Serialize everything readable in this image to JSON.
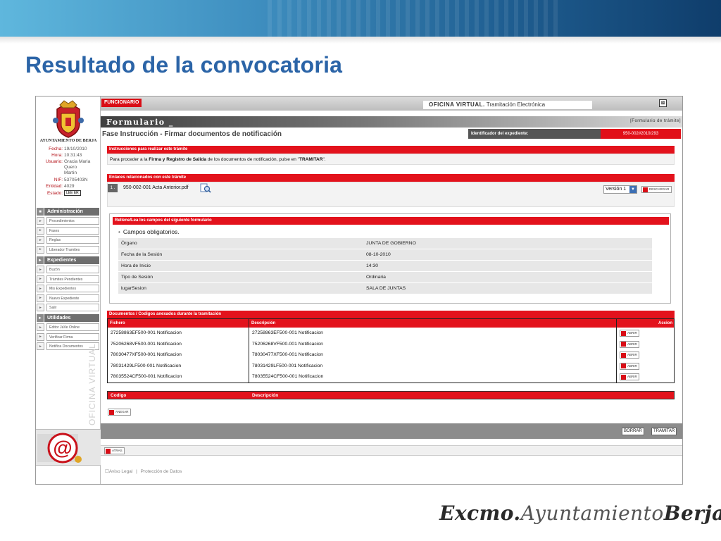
{
  "slide": {
    "title": "Resultado de la convocatoria",
    "footer": {
      "part1": "Excmo.",
      "part2": "Ayuntamiento",
      "part3": "Berja"
    }
  },
  "left": {
    "municipality": "AYUNTAMIENTO DE BERJA",
    "info": [
      {
        "key": "Fecha:",
        "value": "19/10/2010"
      },
      {
        "key": "Hora:",
        "value": "10:31:43"
      },
      {
        "key": "Usuario:",
        "value": "Gracia Maria"
      },
      {
        "key": "",
        "value": "Quero"
      },
      {
        "key": "",
        "value": "Martin"
      },
      {
        "key": "NIF:",
        "value": "53705403N"
      },
      {
        "key": "Entidad:",
        "value": "4029"
      }
    ],
    "estado_key": "Estado:",
    "estado_btn": "LEE ER",
    "vertical_text": "OFICINA VIRTUAL",
    "sections": [
      {
        "title": "Administración",
        "items": [
          "Procedimientos",
          "Fases",
          "Reglas",
          "Liberador Tramites"
        ]
      },
      {
        "title": "Expedientes",
        "items": [
          "Buzón",
          "Trámites Pendientes",
          "Mis Expedientes",
          "Nuevo Expediente",
          "Salir"
        ]
      },
      {
        "title": "Utilidades",
        "items": [
          "Editor JaVe Online",
          "Verificar Firma",
          "Notifica Documentos"
        ]
      }
    ]
  },
  "header": {
    "role_tag": "FUNCIONARIO",
    "app_name": "OFICINA VIRTUAL.",
    "app_sub": "Tramitación Electrónica",
    "close": "⊠"
  },
  "form": {
    "title": "Formulario _",
    "link": "[Formulario de trámite]",
    "phase": "Fase Instrucción - Firmar documentos de notificación",
    "id_label": "Identificador del expediente:",
    "id_value": "950-002#2010/293",
    "instructions_head": "Instrucciones para realizar este trámite",
    "instructions": {
      "t1": "Para proceder a la ",
      "b1": "Firma y Registro de Salida",
      "t2": " de los documentos de notificación, pulse en \"",
      "b2": "TRAMITAR",
      "t3": "\"."
    },
    "links_head": "Enlaces relacionados con este trámite",
    "link_num": "1 .",
    "link_file": "950-002-001 Acta Anterior.pdf",
    "version": "Versión 1",
    "download": "DESCARGAR",
    "fields_head": "Rellene/Lea los campos del siguiente formulario",
    "required_note": "Campos obligatorios.",
    "fields": [
      {
        "label": "Órgano",
        "value": "JUNTA DE GOBIERNO"
      },
      {
        "label": "Fecha de la Sesión",
        "value": "08-10-2010"
      },
      {
        "label": "Hora de Inicio",
        "value": "14:30"
      },
      {
        "label": "Tipo de Sesión",
        "value": "Ordinaria"
      },
      {
        "label": "lugarSesion",
        "value": "SALA DE JUNTAS"
      }
    ],
    "docs_head": "Documentos / Codigos anexados durante la tramitación",
    "docs_cols": {
      "c1": "Fichero",
      "c2": "Descripción",
      "c3": "Accion"
    },
    "open": "ABRIR",
    "docs": [
      {
        "file": "27258863EF500-001 Notificacion",
        "desc": "27258863EF500-001 Notificacion"
      },
      {
        "file": "75206268VF500-001 Notificacion",
        "desc": "75206268VF500-001 Notificacion"
      },
      {
        "file": "78030477XF500-001 Notificacion",
        "desc": "78030477XF500-001 Notificacion"
      },
      {
        "file": "78031429LF500-001 Notificacion",
        "desc": "78031429LF500-001 Notificacion"
      },
      {
        "file": "78035524CF500-001 Notificacion",
        "desc": "78035524CF500-001 Notificacion"
      }
    ],
    "codes_cols": {
      "c1": "Codigo",
      "c2": "Descripción"
    },
    "attach": "ANEXAR",
    "delete": "BORRAR",
    "process": "TRAMITAR",
    "back": "ATRAS",
    "legal": "Aviso Legal",
    "privacy": "Protección de Datos"
  },
  "colors": {
    "accent_red": "#e3121c",
    "title_blue": "#2b64a7"
  }
}
